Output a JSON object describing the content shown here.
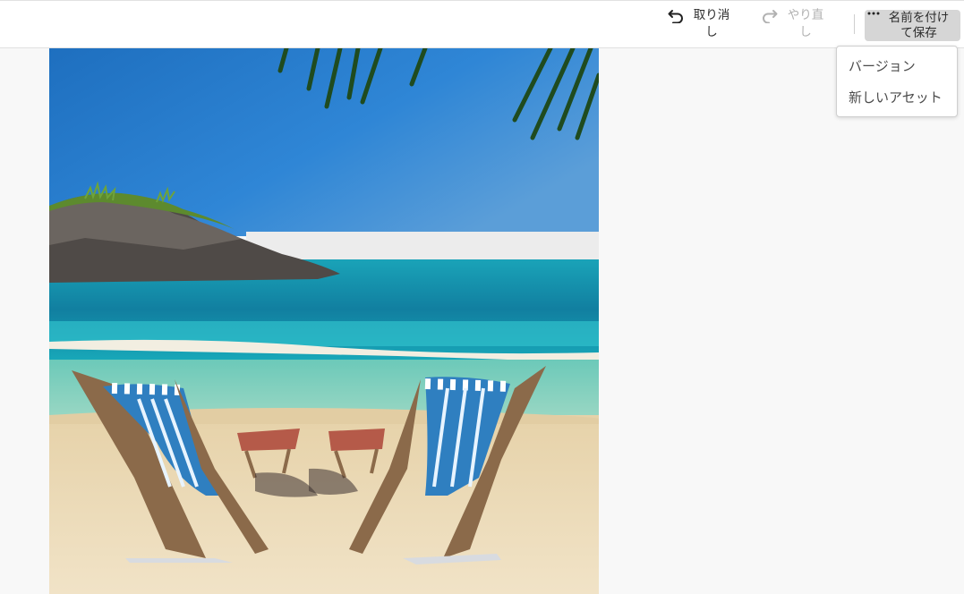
{
  "toolbar": {
    "undo_label": "取り消\nし",
    "redo_label": "やり直\nし",
    "save_as_label": "名前を付け\nて保存"
  },
  "menu": {
    "items": [
      {
        "label": "バージョン"
      },
      {
        "label": "新しいアセット"
      }
    ]
  },
  "colors": {
    "accent_save_bg": "#d6d6d6",
    "disabled_text": "#b1b1b1"
  },
  "icons": {
    "undo": "undo-icon",
    "redo": "redo-icon",
    "more": "more-dots-icon"
  }
}
